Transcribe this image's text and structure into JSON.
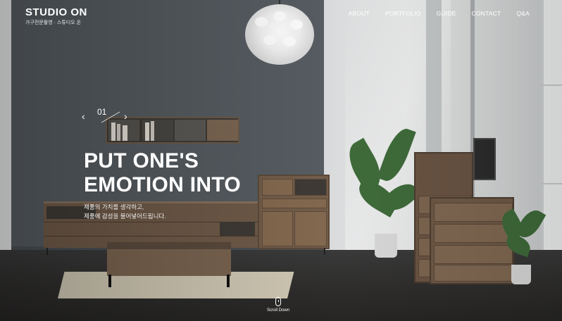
{
  "header": {
    "logo_main": "STUDIO ON",
    "logo_sub": "가구전문촬영 · 스튜디오 온"
  },
  "nav": {
    "items": [
      {
        "label": "ABOUT"
      },
      {
        "label": "PORTFOLIO"
      },
      {
        "label": "GUIDE"
      },
      {
        "label": "CONTACT"
      },
      {
        "label": "Q&A"
      }
    ]
  },
  "slider": {
    "current": "01",
    "prev_icon": "chevron-left-icon",
    "next_icon": "chevron-right-icon"
  },
  "hero": {
    "headline_line1": "PUT ONE'S",
    "headline_line2": "EMOTION INTO",
    "sub_line1": "제품의 가치를 생각하고,",
    "sub_line2": "제품에 감성을 불어넣어드립니다."
  },
  "scroll": {
    "label": "Scroll Down",
    "icon": "mouse-icon"
  },
  "colors": {
    "accent_text": "#ffffff",
    "wall": "#565c61",
    "wood": "#735d4a"
  }
}
